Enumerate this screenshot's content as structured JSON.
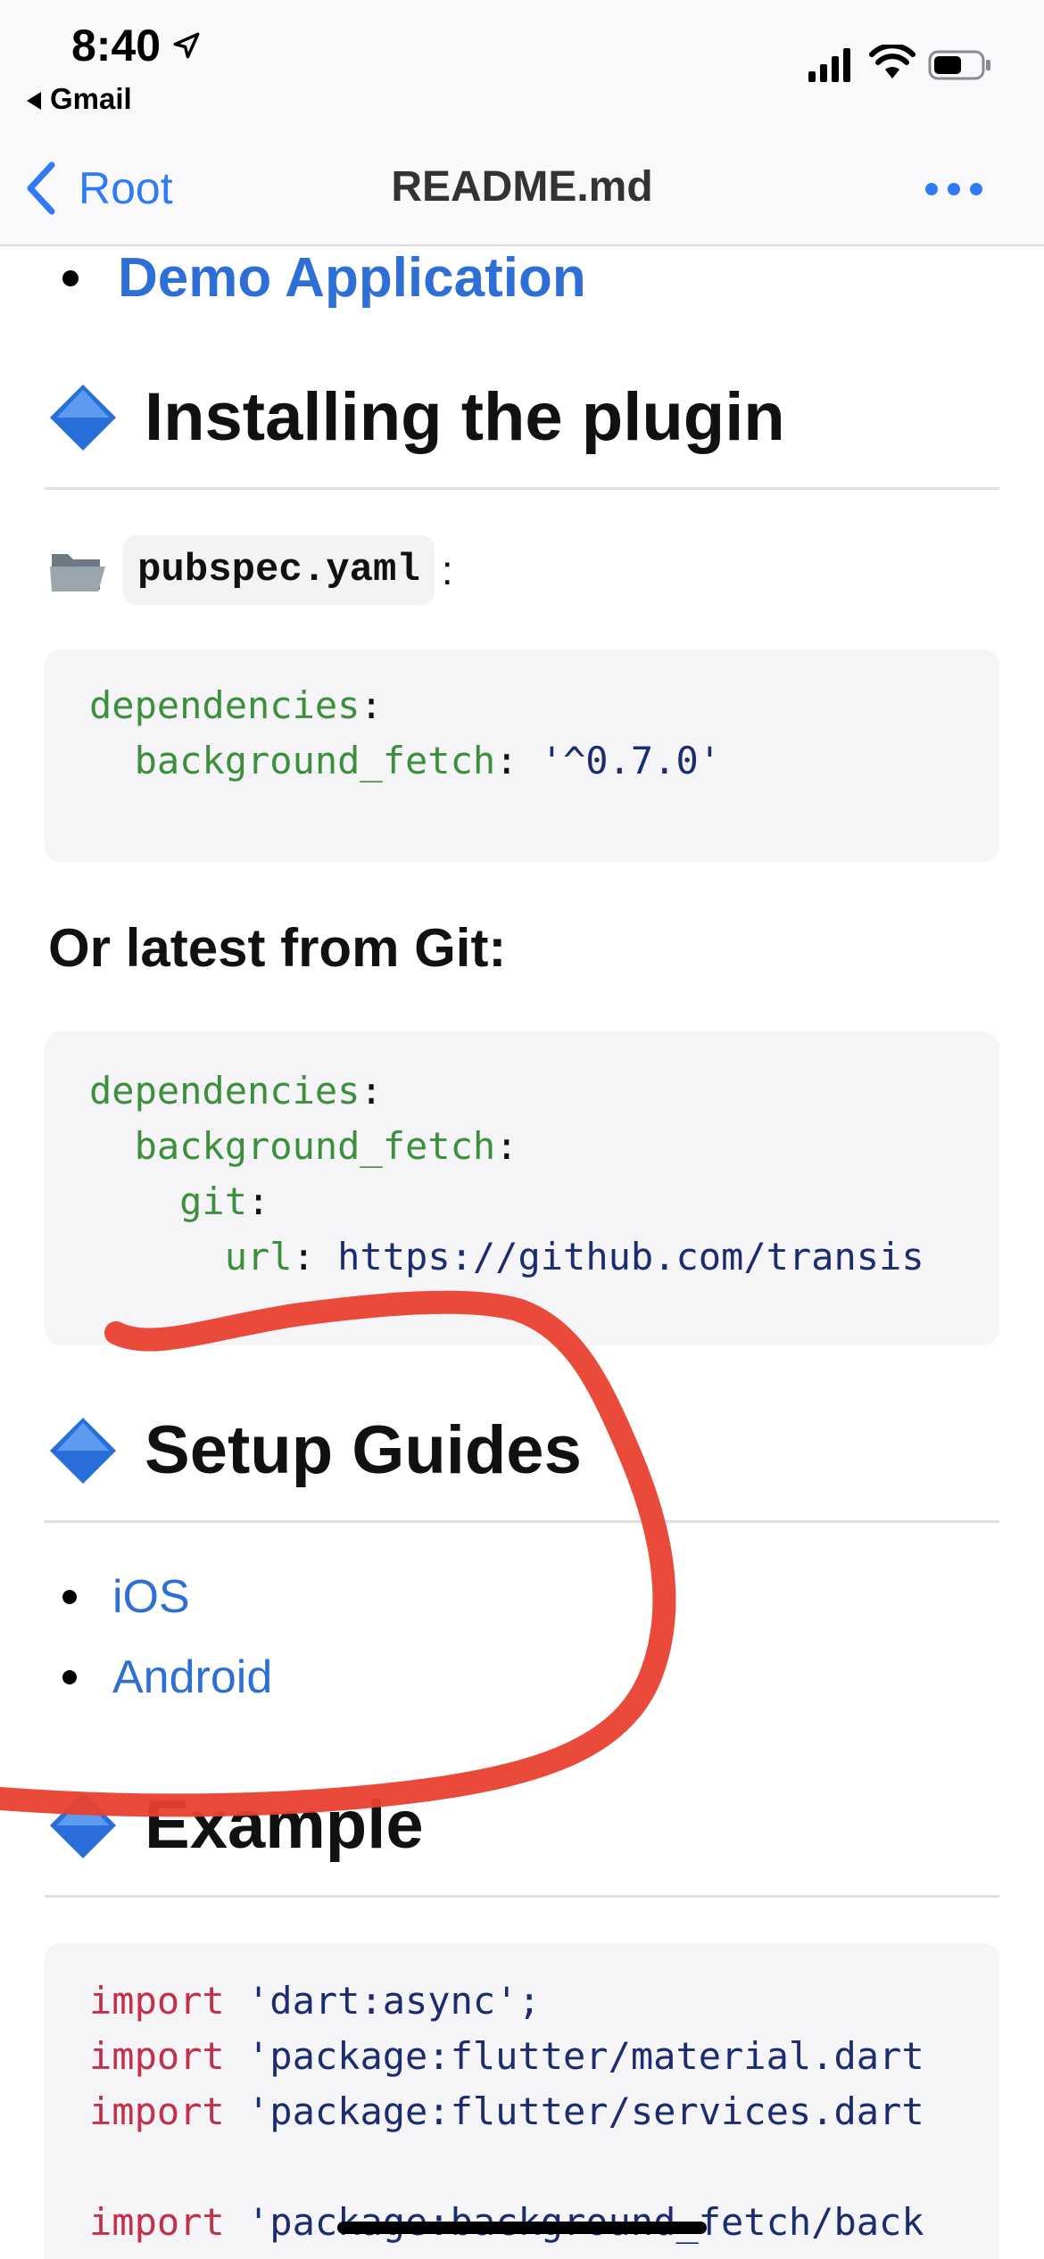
{
  "status_bar": {
    "time": "8:40",
    "back_app": "Gmail"
  },
  "navbar": {
    "back_label": "Root",
    "title": "README.md"
  },
  "content": {
    "top_list_item": "Demo Application",
    "heading_install": "Installing the plugin",
    "pubspec_file": "pubspec.yaml",
    "pubspec_colon": ":",
    "code1": {
      "line1_key": "dependencies",
      "line1_colon": ":",
      "line2_key": "  background_fetch",
      "line2_colon": ": ",
      "line2_val": "'^0.7.0'"
    },
    "subheading_git": "Or latest from Git:",
    "code2": {
      "line1_key": "dependencies",
      "line2_key": "  background_fetch",
      "line3_key": "    git",
      "line4_key": "      url",
      "line4_val": "https://github.com/transis",
      "colon": ":"
    },
    "heading_setup": "Setup Guides",
    "setup_links": [
      "iOS",
      "Android"
    ],
    "heading_example": "Example",
    "code3": {
      "kw": "import",
      "lines": [
        "'dart:async';",
        "'package:flutter/material.dart",
        "'package:flutter/services.dart",
        "'package:background_fetch/back"
      ]
    }
  },
  "colors": {
    "link": "#2e6fd6",
    "ios_blue": "#2f7bf6",
    "annotation_red": "#e8402f",
    "code_green": "#3d8f3d",
    "code_red": "#c4304a"
  }
}
